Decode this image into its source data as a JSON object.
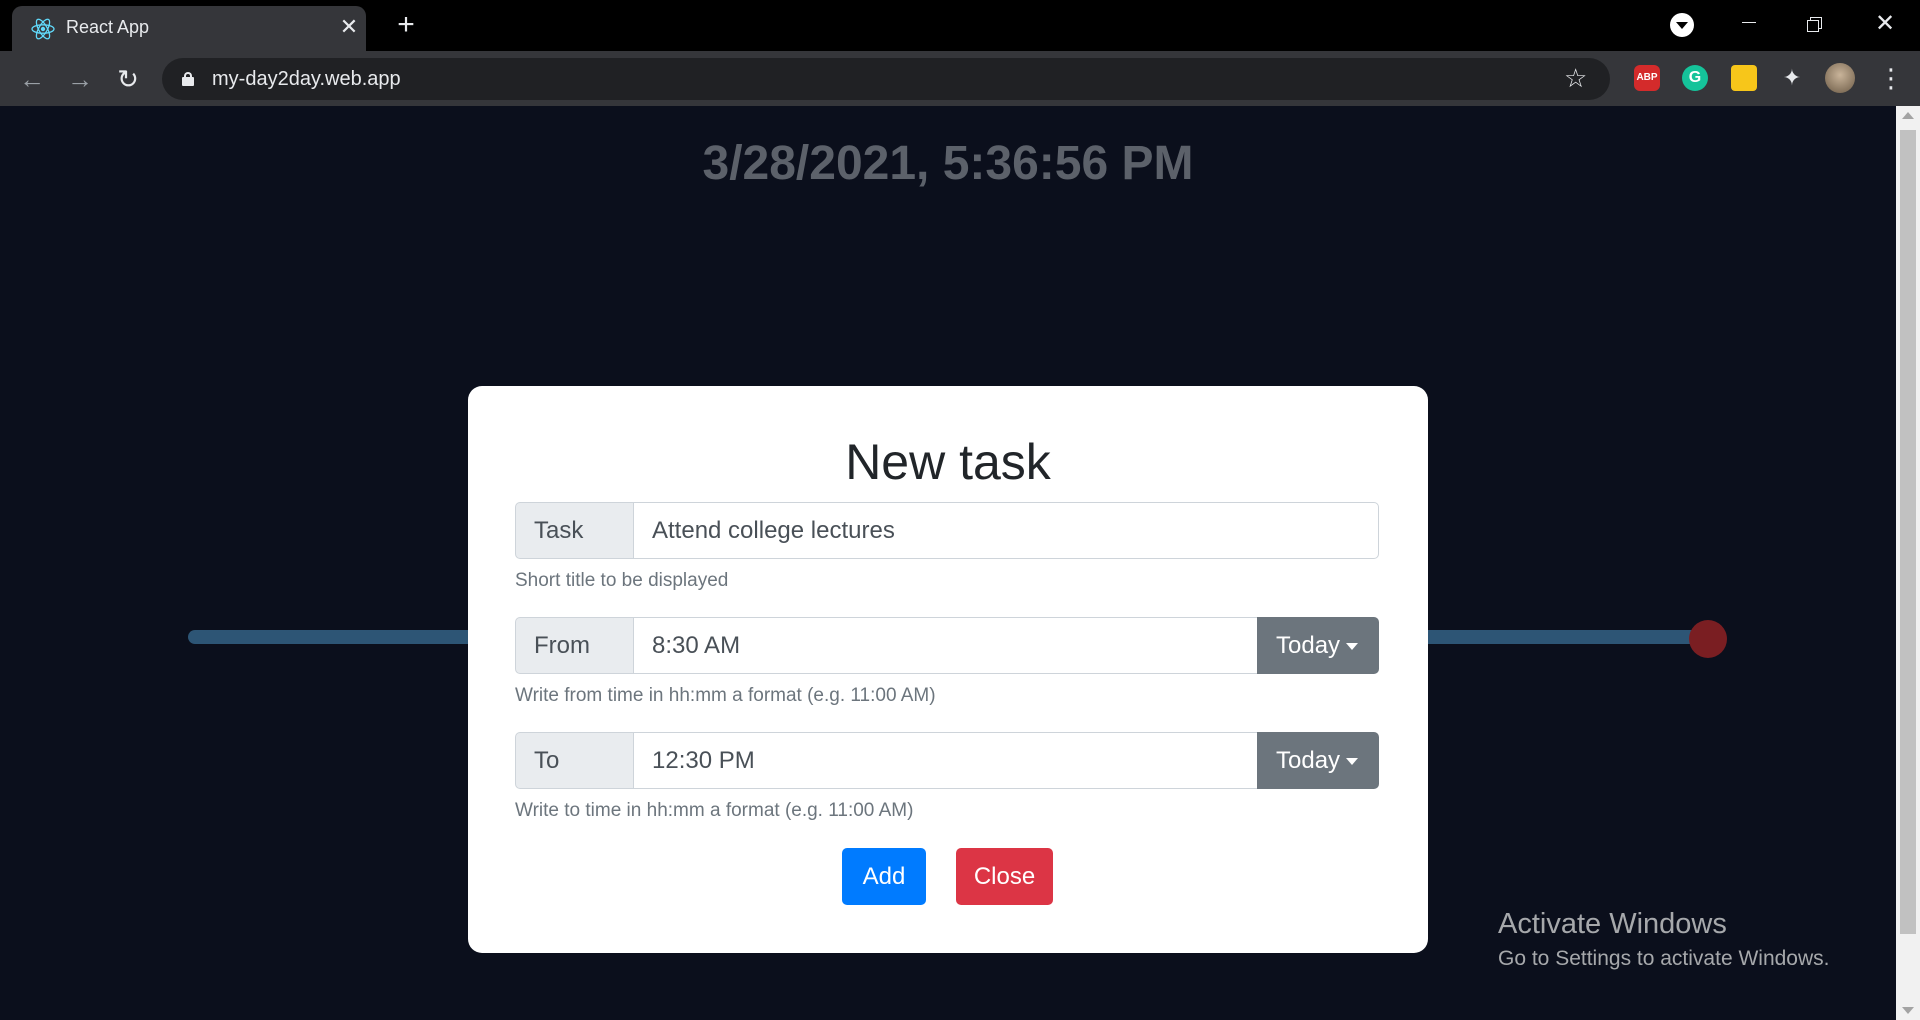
{
  "browser": {
    "tab_title": "React App",
    "url": "my-day2day.web.app",
    "icons": {
      "favicon": "react-icon",
      "back": "arrow-left-icon",
      "forward": "arrow-right-icon",
      "reload": "reload-icon",
      "lock": "lock-icon",
      "star": "star-icon",
      "extensions": [
        "adblock-plus-icon",
        "grammarly-icon",
        "honey-icon",
        "puzzle-icon",
        "avatar-icon"
      ]
    },
    "abp_text": "ABP",
    "grammarly_text": "G"
  },
  "page": {
    "clock": "3/28/2021, 5:36:56 PM",
    "watermark_title": "Activate Windows",
    "watermark_sub": "Go to Settings to activate Windows."
  },
  "modal": {
    "title": "New task",
    "task": {
      "label": "Task",
      "value": "Attend college lectures",
      "help": "Short title to be displayed"
    },
    "from": {
      "label": "From",
      "value": "8:30 AM",
      "day": "Today",
      "help": "Write from time in hh:mm a format (e.g. 11:00 AM)"
    },
    "to": {
      "label": "To",
      "value": "12:30 PM",
      "day": "Today",
      "help": "Write to time in hh:mm a format (e.g. 11:00 AM)"
    },
    "add_label": "Add",
    "close_label": "Close"
  },
  "colors": {
    "background": "#0b0f1c",
    "timeline": "#2d5575",
    "timeline_dot": "#7a1e22",
    "primary": "#007bff",
    "danger": "#dc3545",
    "secondary": "#6c757d"
  }
}
